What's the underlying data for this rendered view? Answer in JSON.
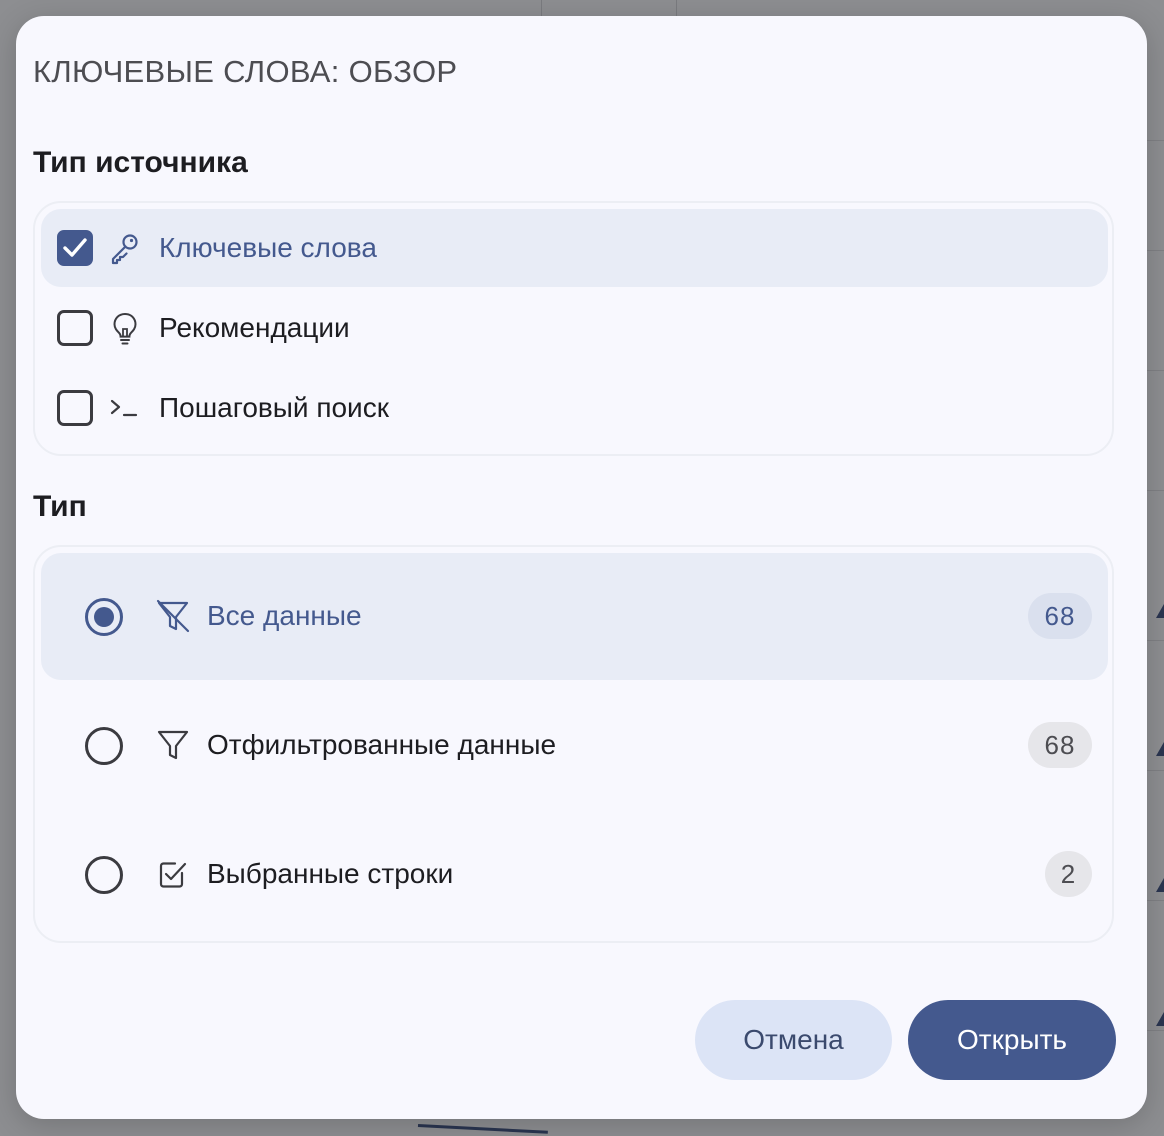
{
  "dialog": {
    "title": "КЛЮЧЕВЫЕ СЛОВА: ОБЗОР",
    "source_section": {
      "title": "Тип источника",
      "items": [
        {
          "label": "Ключевые слова",
          "checked": true,
          "icon": "key-icon"
        },
        {
          "label": "Рекомендации",
          "checked": false,
          "icon": "lightbulb-icon"
        },
        {
          "label": "Пошаговый поиск",
          "checked": false,
          "icon": "terminal-prompt-icon"
        }
      ]
    },
    "type_section": {
      "title": "Тип",
      "items": [
        {
          "label": "Все данные",
          "count": "68",
          "selected": true,
          "icon": "filter-off-icon"
        },
        {
          "label": "Отфильтрованные данные",
          "count": "68",
          "selected": false,
          "icon": "filter-icon"
        },
        {
          "label": "Выбранные строки",
          "count": "2",
          "selected": false,
          "icon": "checked-square-icon"
        }
      ]
    },
    "buttons": {
      "cancel": "Отмена",
      "open": "Открыть"
    }
  },
  "colors": {
    "accent": "#44598e",
    "selected_row_bg": "#e8ecf6",
    "dialog_bg": "#f8f8fe",
    "cancel_bg": "#dce4f6"
  }
}
